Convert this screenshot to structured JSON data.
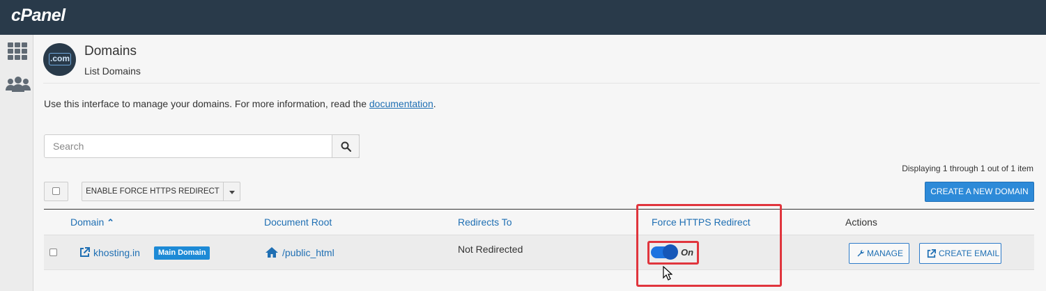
{
  "app": {
    "logo": "cPanel"
  },
  "header": {
    "badge": ".com",
    "title": "Domains",
    "subtitle": "List Domains"
  },
  "intro": {
    "text": "Use this interface to manage your domains. For more information, read the ",
    "link": "documentation",
    "suffix": "."
  },
  "search": {
    "placeholder": "Search"
  },
  "pagination": {
    "text": "Displaying 1 through 1 out of 1 item"
  },
  "toolbar": {
    "force_label": "ENABLE FORCE HTTPS REDIRECT",
    "create_label": "CREATE A NEW DOMAIN"
  },
  "table": {
    "columns": [
      "Domain",
      "Document Root",
      "Redirects To",
      "Force HTTPS Redirect",
      "Actions"
    ],
    "sort_arrow": "⌃",
    "rows": [
      {
        "domain": "khosting.in",
        "badge": "Main Domain",
        "doc_root": "/public_html",
        "redirects_to": "Not Redirected",
        "force_https": "On",
        "force_https_on": true,
        "manage_label": "MANAGE",
        "email_label": "CREATE EMAIL"
      }
    ]
  },
  "colors": {
    "topbar": "#293a4a",
    "accent": "#1d8ad6",
    "highlight": "#e0353d"
  }
}
